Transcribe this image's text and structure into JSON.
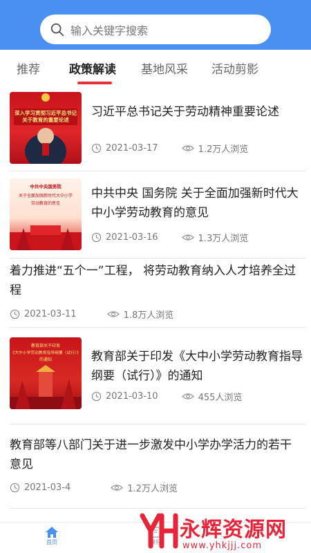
{
  "search": {
    "placeholder": "输入关键字搜索"
  },
  "tabs": [
    {
      "label": "推荐"
    },
    {
      "label": "政策解读"
    },
    {
      "label": "基地风采"
    },
    {
      "label": "活动剪影"
    }
  ],
  "articles": [
    {
      "title": "习近平总书记关于劳动精神重要论述",
      "date": "2021-03-17",
      "views": "1.2万人浏览",
      "thumb_text": "深入学习贯彻习近平总书记关于教育的重要论述"
    },
    {
      "title": "中共中央 国务院 关于全面加强新时代大中小学劳动教育的意见",
      "date": "2021-03-16",
      "views": "1.3万人浏览",
      "thumb_text": "中共中央国务院关于全面加强新时代大中小学劳动教育的意见"
    },
    {
      "title": "着力推进“五个一”工程， 将劳动教育纳入人才培养全过程",
      "date": "2021-03-11",
      "views": "1.8万人浏览"
    },
    {
      "title": "教育部关于印发《大中小学劳动教育指导纲要（试行）》的通知",
      "date": "2021-03-10",
      "views": "455人浏览",
      "thumb_text": "教育部关于印发《大中小学劳动教育指导纲要（试行）》的通知"
    },
    {
      "title": "教育部等八部门关于进一步激发中小学办学活力的若干意见",
      "date": "2021-03-4",
      "views": "1.2万人浏览"
    }
  ],
  "bottom_nav": [
    {
      "label": "首页",
      "icon": "home-icon"
    },
    {
      "label": "课程",
      "icon": "course-icon"
    }
  ],
  "watermark": {
    "logo": "YH",
    "text": "永辉资源网",
    "url": "www.yhkjjj.com"
  },
  "colors": {
    "header": "#4a90f0",
    "accent": "#e5323a",
    "watermark": "#e6253a"
  }
}
